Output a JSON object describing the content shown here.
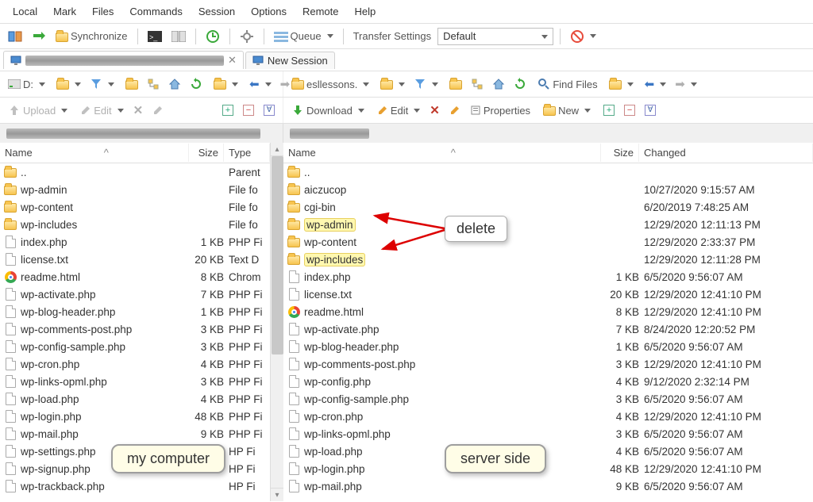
{
  "menu": {
    "local": "Local",
    "mark": "Mark",
    "files": "Files",
    "commands": "Commands",
    "session": "Session",
    "options": "Options",
    "remote": "Remote",
    "help": "Help"
  },
  "toolbar1": {
    "sync": "Synchronize",
    "queue": "Queue",
    "ts_label": "Transfer Settings",
    "ts_value": "Default"
  },
  "tabs": {
    "new": "New Session",
    "close": "✕"
  },
  "nav": {
    "drive": "D:",
    "remote_dir": "esllessons.",
    "find": "Find Files"
  },
  "actions": {
    "upload": "Upload",
    "edit": "Edit",
    "download": "Download",
    "edit2": "Edit",
    "props": "Properties",
    "new": "New"
  },
  "headers": {
    "name": "Name",
    "size": "Size",
    "type": "Type",
    "changed": "Changed"
  },
  "local_rows": [
    {
      "ic": "folder",
      "name": "..",
      "size": "",
      "type": "Parent"
    },
    {
      "ic": "folder",
      "name": "wp-admin",
      "size": "",
      "type": "File fo"
    },
    {
      "ic": "folder",
      "name": "wp-content",
      "size": "",
      "type": "File fo"
    },
    {
      "ic": "folder",
      "name": "wp-includes",
      "size": "",
      "type": "File fo"
    },
    {
      "ic": "file",
      "name": "index.php",
      "size": "1 KB",
      "type": "PHP Fi"
    },
    {
      "ic": "file",
      "name": "license.txt",
      "size": "20 KB",
      "type": "Text D"
    },
    {
      "ic": "chrome",
      "name": "readme.html",
      "size": "8 KB",
      "type": "Chrom"
    },
    {
      "ic": "file",
      "name": "wp-activate.php",
      "size": "7 KB",
      "type": "PHP Fi"
    },
    {
      "ic": "file",
      "name": "wp-blog-header.php",
      "size": "1 KB",
      "type": "PHP Fi"
    },
    {
      "ic": "file",
      "name": "wp-comments-post.php",
      "size": "3 KB",
      "type": "PHP Fi"
    },
    {
      "ic": "file",
      "name": "wp-config-sample.php",
      "size": "3 KB",
      "type": "PHP Fi"
    },
    {
      "ic": "file",
      "name": "wp-cron.php",
      "size": "4 KB",
      "type": "PHP Fi"
    },
    {
      "ic": "file",
      "name": "wp-links-opml.php",
      "size": "3 KB",
      "type": "PHP Fi"
    },
    {
      "ic": "file",
      "name": "wp-load.php",
      "size": "4 KB",
      "type": "PHP Fi"
    },
    {
      "ic": "file",
      "name": "wp-login.php",
      "size": "48 KB",
      "type": "PHP Fi"
    },
    {
      "ic": "file",
      "name": "wp-mail.php",
      "size": "9 KB",
      "type": "PHP Fi"
    },
    {
      "ic": "file",
      "name": "wp-settings.php",
      "size": "",
      "type": "HP Fi"
    },
    {
      "ic": "file",
      "name": "wp-signup.php",
      "size": "",
      "type": "HP Fi"
    },
    {
      "ic": "file",
      "name": "wp-trackback.php",
      "size": "",
      "type": "HP Fi"
    }
  ],
  "remote_rows": [
    {
      "ic": "folder",
      "name": "..",
      "size": "",
      "changed": ""
    },
    {
      "ic": "folder",
      "name": "aiczucop",
      "size": "",
      "changed": "10/27/2020 9:15:57 AM"
    },
    {
      "ic": "folder",
      "name": "cgi-bin",
      "size": "",
      "changed": "6/20/2019 7:48:25 AM"
    },
    {
      "ic": "folder",
      "name": "wp-admin",
      "hl": true,
      "size": "",
      "changed": "12/29/2020 12:11:13 PM"
    },
    {
      "ic": "folder",
      "name": "wp-content",
      "size": "",
      "changed": "12/29/2020 2:33:37 PM"
    },
    {
      "ic": "folder",
      "name": "wp-includes",
      "hl": true,
      "size": "",
      "changed": "12/29/2020 12:11:28 PM"
    },
    {
      "ic": "file",
      "name": "index.php",
      "size": "1 KB",
      "changed": "6/5/2020 9:56:07 AM"
    },
    {
      "ic": "file",
      "name": "license.txt",
      "size": "20 KB",
      "changed": "12/29/2020 12:41:10 PM"
    },
    {
      "ic": "chrome",
      "name": "readme.html",
      "size": "8 KB",
      "changed": "12/29/2020 12:41:10 PM"
    },
    {
      "ic": "file",
      "name": "wp-activate.php",
      "size": "7 KB",
      "changed": "8/24/2020 12:20:52 PM"
    },
    {
      "ic": "file",
      "name": "wp-blog-header.php",
      "size": "1 KB",
      "changed": "6/5/2020 9:56:07 AM"
    },
    {
      "ic": "file",
      "name": "wp-comments-post.php",
      "size": "3 KB",
      "changed": "12/29/2020 12:41:10 PM"
    },
    {
      "ic": "file",
      "name": "wp-config.php",
      "size": "4 KB",
      "changed": "9/12/2020 2:32:14 PM"
    },
    {
      "ic": "file",
      "name": "wp-config-sample.php",
      "size": "3 KB",
      "changed": "6/5/2020 9:56:07 AM"
    },
    {
      "ic": "file",
      "name": "wp-cron.php",
      "size": "4 KB",
      "changed": "12/29/2020 12:41:10 PM"
    },
    {
      "ic": "file",
      "name": "wp-links-opml.php",
      "size": "3 KB",
      "changed": "6/5/2020 9:56:07 AM"
    },
    {
      "ic": "file",
      "name": "wp-load.php",
      "size": "4 KB",
      "changed": "6/5/2020 9:56:07 AM"
    },
    {
      "ic": "file",
      "name": "wp-login.php",
      "size": "48 KB",
      "changed": "12/29/2020 12:41:10 PM"
    },
    {
      "ic": "file",
      "name": "wp-mail.php",
      "size": "9 KB",
      "changed": "6/5/2020 9:56:07 AM"
    }
  ],
  "annot": {
    "delete": "delete",
    "my": "my computer",
    "server": "server side"
  }
}
